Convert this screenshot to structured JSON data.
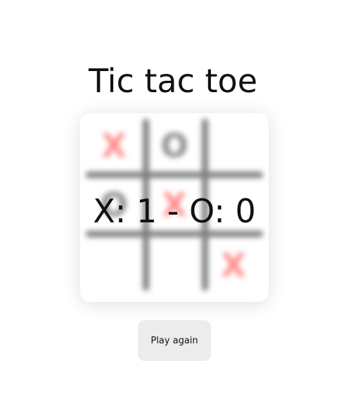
{
  "title": "Tic tac toe",
  "score_text": "X: 1 - O: 0",
  "board": {
    "cells": [
      "X",
      "O",
      "",
      "O",
      "X",
      "",
      "",
      "",
      "X"
    ]
  },
  "play_again_label": "Play again",
  "colors": {
    "x_mark": "#ff8a8a",
    "o_mark": "#8a8a8a",
    "grid": "#7f7f7f",
    "button_bg": "#ececec"
  }
}
